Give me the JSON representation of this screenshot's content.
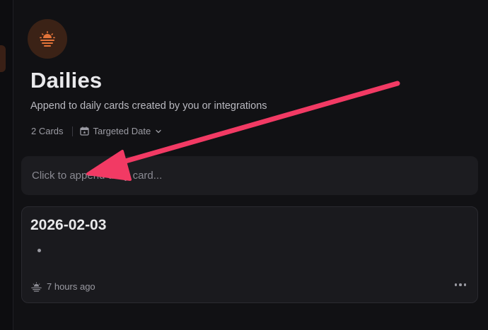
{
  "header": {
    "title": "Dailies",
    "subtitle": "Append to daily cards created by you or integrations",
    "icon": "sunrise-icon",
    "icon_color": "#e4743a"
  },
  "meta": {
    "card_count": "2 Cards",
    "sort_label": "Targeted Date",
    "sort_icon": "calendar-icon"
  },
  "append": {
    "placeholder": "Click to append daily card..."
  },
  "cards": [
    {
      "title": "2026-02-03",
      "timestamp": "7 hours ago",
      "source_icon": "sunrise-icon"
    }
  ],
  "annotation": {
    "arrow_color": "#f23a64"
  }
}
